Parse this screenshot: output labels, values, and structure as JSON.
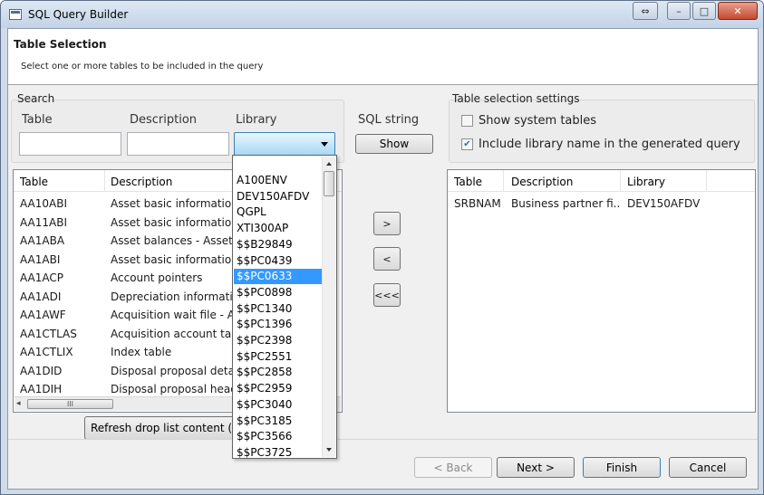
{
  "window": {
    "title": "SQL Query Builder",
    "controls": {
      "extra": "⇔",
      "minimize": "–",
      "maximize": "□",
      "close": "✕"
    }
  },
  "header": {
    "title": "Table Selection",
    "subtitle": "Select one or more tables to be included in the query"
  },
  "search": {
    "group_label": "Search",
    "table_label": "Table",
    "table_value": "",
    "description_label": "Description",
    "description_value": "",
    "library_label": "Library",
    "library_value": ""
  },
  "sql_string": {
    "label": "SQL string",
    "show_button": "Show"
  },
  "settings": {
    "group_label": "Table selection settings",
    "show_system_tables": {
      "label": "Show system tables",
      "checked": false
    },
    "include_library": {
      "label": "Include library name in the generated query",
      "checked": true
    }
  },
  "left_table": {
    "columns": [
      "Table",
      "Description"
    ],
    "rows": [
      [
        "AA10ABI",
        "Asset basic information"
      ],
      [
        "AA11ABI",
        "Asset basic information"
      ],
      [
        "AA1ABA",
        "Asset balances  - Asset r"
      ],
      [
        "AA1ABI",
        "Asset basic information"
      ],
      [
        "AA1ACP",
        "Account pointers"
      ],
      [
        "AA1ADI",
        "Depreciation informatio"
      ],
      [
        "AA1AWF",
        "Acquisition wait file - Ac"
      ],
      [
        "AA1CTLAS",
        "Acquisition account tab"
      ],
      [
        "AA1CTLIX",
        "Index table"
      ],
      [
        "AA1DID",
        "Disposal proposal detail"
      ],
      [
        "AA1DIH",
        "Disposal proposal head"
      ]
    ],
    "scroll_grip": "III",
    "scroll_left": "◂"
  },
  "refresh_button": "Refresh drop list content (Li",
  "move_buttons": {
    "add": ">",
    "remove": "<",
    "remove_all": "<<<"
  },
  "right_table": {
    "columns": [
      "Table",
      "Description",
      "Library"
    ],
    "rows": [
      [
        "SRBNAM",
        "Business partner fi...",
        "DEV150AFDV"
      ]
    ]
  },
  "library_dropdown": {
    "items": [
      "A100ENV",
      "DEV150AFDV",
      "QGPL",
      "XTI300AP",
      "$$B29849",
      "$$PC0439",
      "$$PC0633",
      "$$PC0898",
      "$$PC1340",
      "$$PC1396",
      "$$PC2398",
      "$$PC2551",
      "$$PC2858",
      "$$PC2959",
      "$$PC3040",
      "$$PC3185",
      "$$PC3566",
      "$$PC3725"
    ],
    "selected_index": 6
  },
  "footer": {
    "back": "< Back",
    "next": "Next >",
    "finish": "Finish",
    "cancel": "Cancel"
  }
}
